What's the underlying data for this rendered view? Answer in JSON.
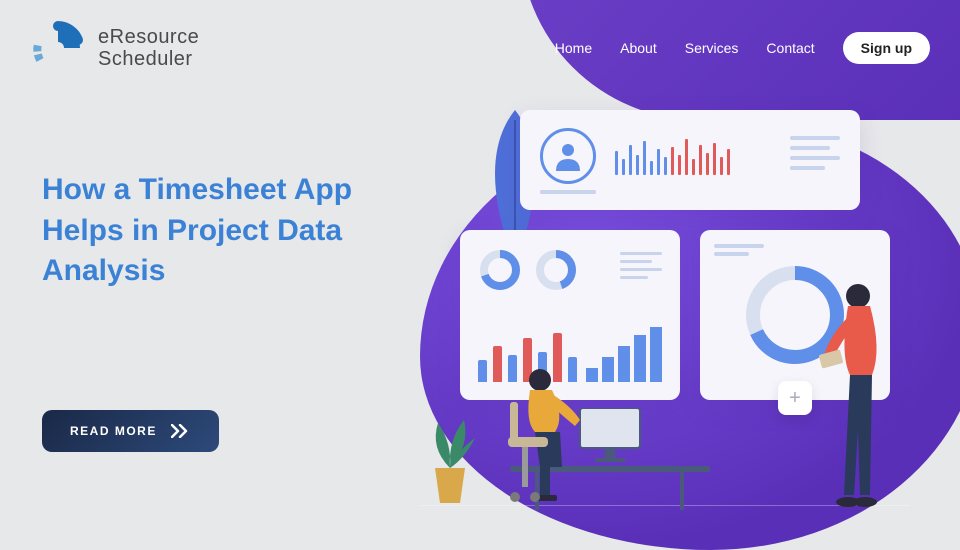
{
  "logo": {
    "line1": "eResource",
    "line2": "Scheduler"
  },
  "nav": {
    "home": "Home",
    "about": "About",
    "services": "Services",
    "contact": "Contact",
    "signup": "Sign up"
  },
  "hero": {
    "title": "How a Timesheet App Helps in Project Data Analysis",
    "cta": "READ MORE"
  },
  "colors": {
    "accent": "#3b82d6",
    "blob": "#5a2fb8",
    "cta_bg": "#1a2847"
  }
}
